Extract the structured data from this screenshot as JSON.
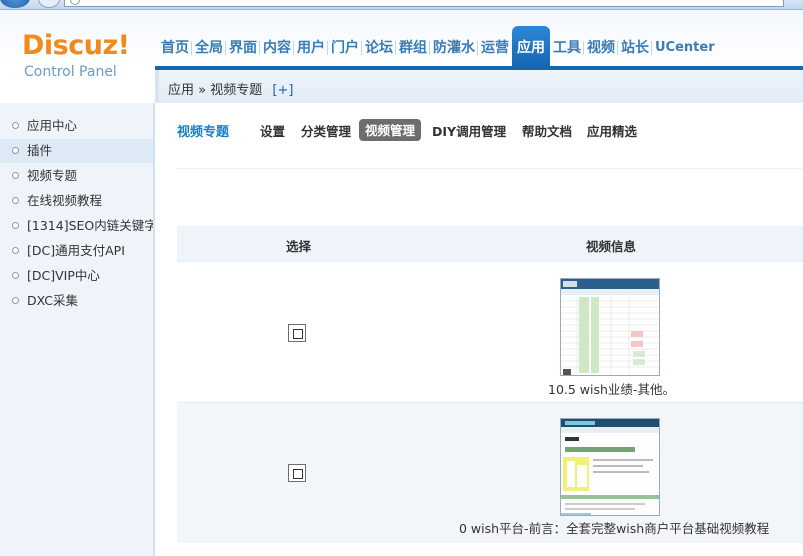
{
  "brand": {
    "name": "Discuz!",
    "subtitle": "Control Panel"
  },
  "nav": {
    "items": [
      {
        "label": "首页"
      },
      {
        "label": "全局"
      },
      {
        "label": "界面"
      },
      {
        "label": "内容"
      },
      {
        "label": "用户"
      },
      {
        "label": "门户"
      },
      {
        "label": "论坛"
      },
      {
        "label": "群组"
      },
      {
        "label": "防灌水"
      },
      {
        "label": "运营"
      },
      {
        "label": "应用",
        "active": true
      },
      {
        "label": "工具"
      },
      {
        "label": "视频"
      },
      {
        "label": "站长"
      },
      {
        "label": "UCenter"
      }
    ]
  },
  "breadcrumb": {
    "parent": "应用",
    "sep": "»",
    "current": "视频专题",
    "add": "[+]"
  },
  "sidebar": {
    "items": [
      {
        "label": "应用中心"
      },
      {
        "label": "插件",
        "active": true
      },
      {
        "label": "视频专题"
      },
      {
        "label": "在线视频教程"
      },
      {
        "label": "[1314]SEO内链关键字"
      },
      {
        "label": "[DC]通用支付API"
      },
      {
        "label": "[DC]VIP中心"
      },
      {
        "label": "DXC采集"
      }
    ]
  },
  "tabs": {
    "title": "视频专题",
    "items": [
      {
        "label": "设置"
      },
      {
        "label": "分类管理"
      },
      {
        "label": "视频管理",
        "active": true
      },
      {
        "label": "DIY调用管理"
      },
      {
        "label": "帮助文档"
      },
      {
        "label": "应用精选"
      }
    ]
  },
  "table": {
    "headers": {
      "select": "选择",
      "info": "视频信息"
    },
    "rows": [
      {
        "caption": "10.5 wish业绩-其他。",
        "checked": false
      },
      {
        "caption": "0 wish平台-前言：全套完整wish商户平台基础视频教程",
        "checked": false
      }
    ]
  },
  "colors": {
    "accent": "#1567b4",
    "logo": "#f08a1c",
    "nav_text": "#3b7cb5"
  }
}
